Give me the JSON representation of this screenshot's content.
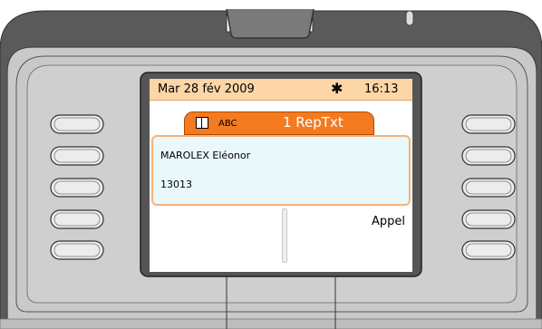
{
  "status": {
    "date": "Mar 28 fév 2009",
    "icon": "sun-icon",
    "time": "16:13"
  },
  "title": {
    "icon": "book-icon",
    "abc": "ABC",
    "label": "1 RepTxt"
  },
  "entry": {
    "name": "MAROLEX Eléonor",
    "number": "13013"
  },
  "softkeys": {
    "right_4": "Appel"
  },
  "colors": {
    "status_bar": "#fcd6a6",
    "title_tab": "#f47a20",
    "entry_bg": "#e8f8fb",
    "entry_border": "#f7b277",
    "body_gray": "#c9c9c9"
  }
}
